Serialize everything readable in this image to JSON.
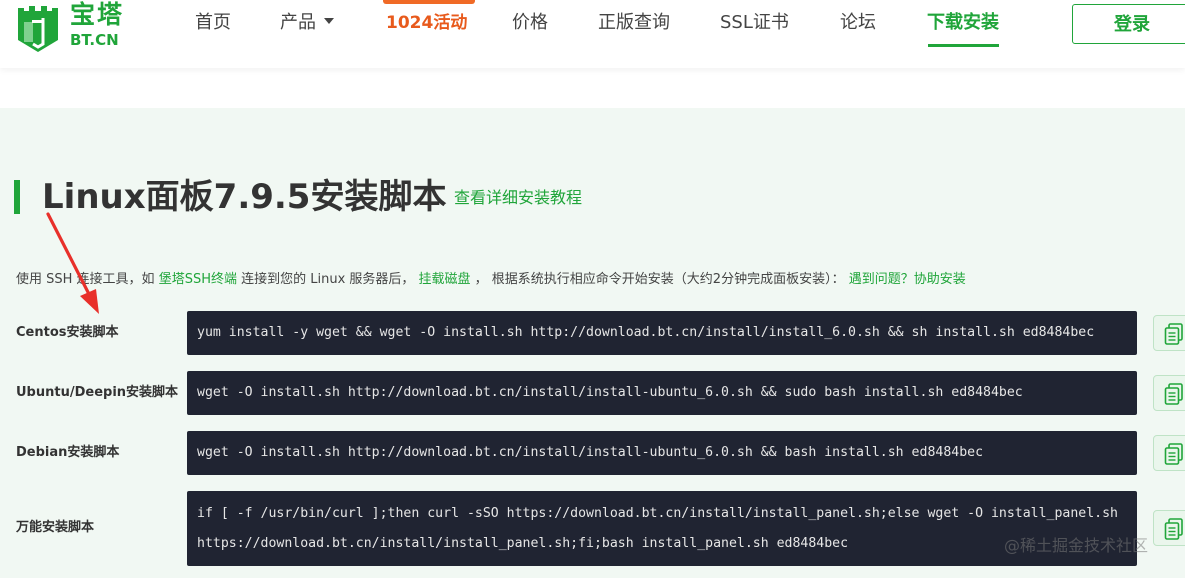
{
  "brand": {
    "name_cn": "宝塔",
    "name_en": "BT.CN",
    "color": "#20a53a"
  },
  "nav": {
    "items": [
      {
        "label": "首页"
      },
      {
        "label": "产品"
      },
      {
        "label": "1024活动"
      },
      {
        "label": "价格"
      },
      {
        "label": "正版查询"
      },
      {
        "label": "SSL证书"
      },
      {
        "label": "论坛"
      },
      {
        "label": "下载安装"
      }
    ],
    "active": "下载安装",
    "login_label": "登录"
  },
  "page": {
    "title": "Linux面板7.9.5安装脚本",
    "tutorial_link": "查看详细安装教程",
    "desc": {
      "part1": "使用 SSH 连接工具，如 ",
      "link1": "堡塔SSH终端",
      "part2": " 连接到您的 Linux 服务器后， ",
      "link2": "挂载磁盘",
      "part3": " ， 根据系统执行相应命令开始安装（大约2分钟完成面板安装）： ",
      "link3": "遇到问题？协助安装"
    }
  },
  "scripts": [
    {
      "label": "Centos安装脚本",
      "lines": [
        "yum install -y wget && wget -O install.sh http://download.bt.cn/install/install_6.0.sh && sh install.sh ed8484bec"
      ]
    },
    {
      "label": "Ubuntu/Deepin安装脚本",
      "lines": [
        "wget -O install.sh http://download.bt.cn/install/install-ubuntu_6.0.sh && sudo bash install.sh ed8484bec"
      ]
    },
    {
      "label": "Debian安装脚本",
      "lines": [
        "wget -O install.sh http://download.bt.cn/install/install-ubuntu_6.0.sh && bash install.sh ed8484bec"
      ]
    },
    {
      "label": "万能安装脚本",
      "lines": [
        "if [ -f /usr/bin/curl ];then curl -sSO https://download.bt.cn/install/install_panel.sh;else wget -O install_panel.sh",
        "https://download.bt.cn/install/install_panel.sh;fi;bash install_panel.sh ed8484bec"
      ]
    }
  ],
  "watermark": "@稀土掘金技术社区",
  "icons": {
    "logo": "shield-logo-icon",
    "copy": "copy-icon",
    "annotation": "red-arrow-annotation"
  }
}
